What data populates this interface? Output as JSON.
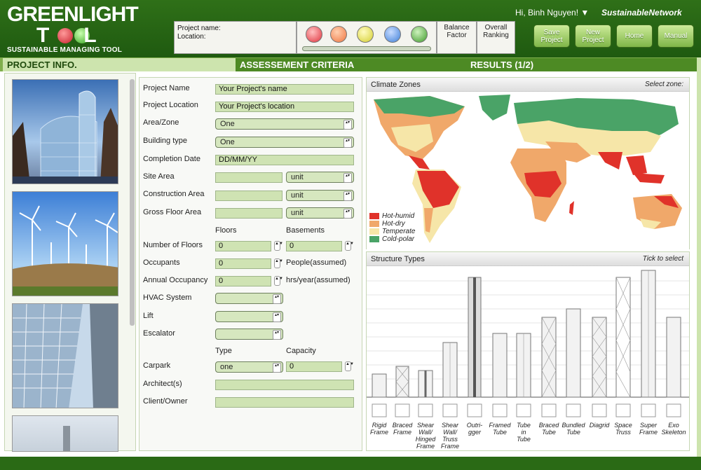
{
  "header": {
    "logo_line1": "GREENLIGHT",
    "logo_line2": "TOOL",
    "logo_sub": "SUSTAINABLE MANAGING TOOL",
    "project_name_label": "Project name:",
    "location_label": "Location:",
    "balance_factor": "Balance Factor",
    "overall_ranking": "Overall Ranking",
    "greeting": "Hi, Binh Nguyen!",
    "brand": "SustainableNetwork",
    "buttons": [
      "Save Project",
      "New Project",
      "Home",
      "Manual"
    ],
    "ball_colors": [
      "#e0333e",
      "#f07540",
      "#e6e040",
      "#3e7fd8",
      "#3f9a2b"
    ]
  },
  "tabs": [
    "PROJECT INFO.",
    "ASSESSEMENT CRITERIA",
    "RESULTS (1/2)"
  ],
  "form": {
    "project_name": {
      "label": "Project Name",
      "value": "Your Project's name"
    },
    "project_location": {
      "label": "Project Location",
      "value": "Your Project's location"
    },
    "area_zone": {
      "label": "Area/Zone",
      "value": "One"
    },
    "building_type": {
      "label": "Building type",
      "value": "One"
    },
    "completion_date": {
      "label": "Completion Date",
      "value": "DD/MM/YY"
    },
    "site_area": {
      "label": "Site Area",
      "unit": "unit"
    },
    "construction_area": {
      "label": "Construction Area",
      "unit": "unit"
    },
    "gross_floor_area": {
      "label": "Gross Floor Area",
      "unit": "unit"
    },
    "floors_header": "Floors",
    "basements_header": "Basements",
    "number_of_floors": {
      "label": "Number of Floors",
      "floors": "0",
      "basements": "0"
    },
    "occupants": {
      "label": "Occupants",
      "value": "0",
      "suffix": "People(assumed)"
    },
    "annual_occupancy": {
      "label": "Annual Occupancy",
      "value": "0",
      "suffix": "hrs/year(assumed)"
    },
    "hvac": {
      "label": "HVAC System"
    },
    "lift": {
      "label": "Lift"
    },
    "escalator": {
      "label": "Escalator"
    },
    "type_header": "Type",
    "capacity_header": "Capacity",
    "carpark": {
      "label": "Carpark",
      "type": "one",
      "capacity": "0"
    },
    "architect": {
      "label": "Architect(s)"
    },
    "client": {
      "label": "Client/Owner"
    }
  },
  "climate": {
    "title": "Climate Zones",
    "hint": "Select zone:",
    "legend": [
      {
        "label": "Hot-humid",
        "color": "#e0322a"
      },
      {
        "label": "Hot-dry",
        "color": "#f0a86a"
      },
      {
        "label": "Temperate",
        "color": "#f6e6a8"
      },
      {
        "label": "Cold-polar",
        "color": "#4aa367"
      }
    ]
  },
  "structures": {
    "title": "Structure Types",
    "hint": "Tick to select",
    "items": [
      {
        "label": [
          "Rigid",
          "Frame"
        ]
      },
      {
        "label": [
          "Braced",
          "Frame"
        ]
      },
      {
        "label": [
          "Shear",
          "Wall/",
          "Hinged",
          "Frame"
        ]
      },
      {
        "label": [
          "Shear",
          "Wall/",
          "Truss",
          "Frame"
        ]
      },
      {
        "label": [
          "Outri-",
          "gger"
        ]
      },
      {
        "label": [
          "Framed",
          "Tube"
        ]
      },
      {
        "label": [
          "Tube",
          "in",
          "Tube"
        ]
      },
      {
        "label": [
          "Braced",
          "Tube"
        ]
      },
      {
        "label": [
          "Bundled",
          "Tube"
        ]
      },
      {
        "label": [
          "Diagrid"
        ]
      },
      {
        "label": [
          "Space",
          "Truss"
        ]
      },
      {
        "label": [
          "Super",
          "Frame"
        ]
      },
      {
        "label": [
          "Exo",
          "Skeleton"
        ]
      }
    ]
  }
}
